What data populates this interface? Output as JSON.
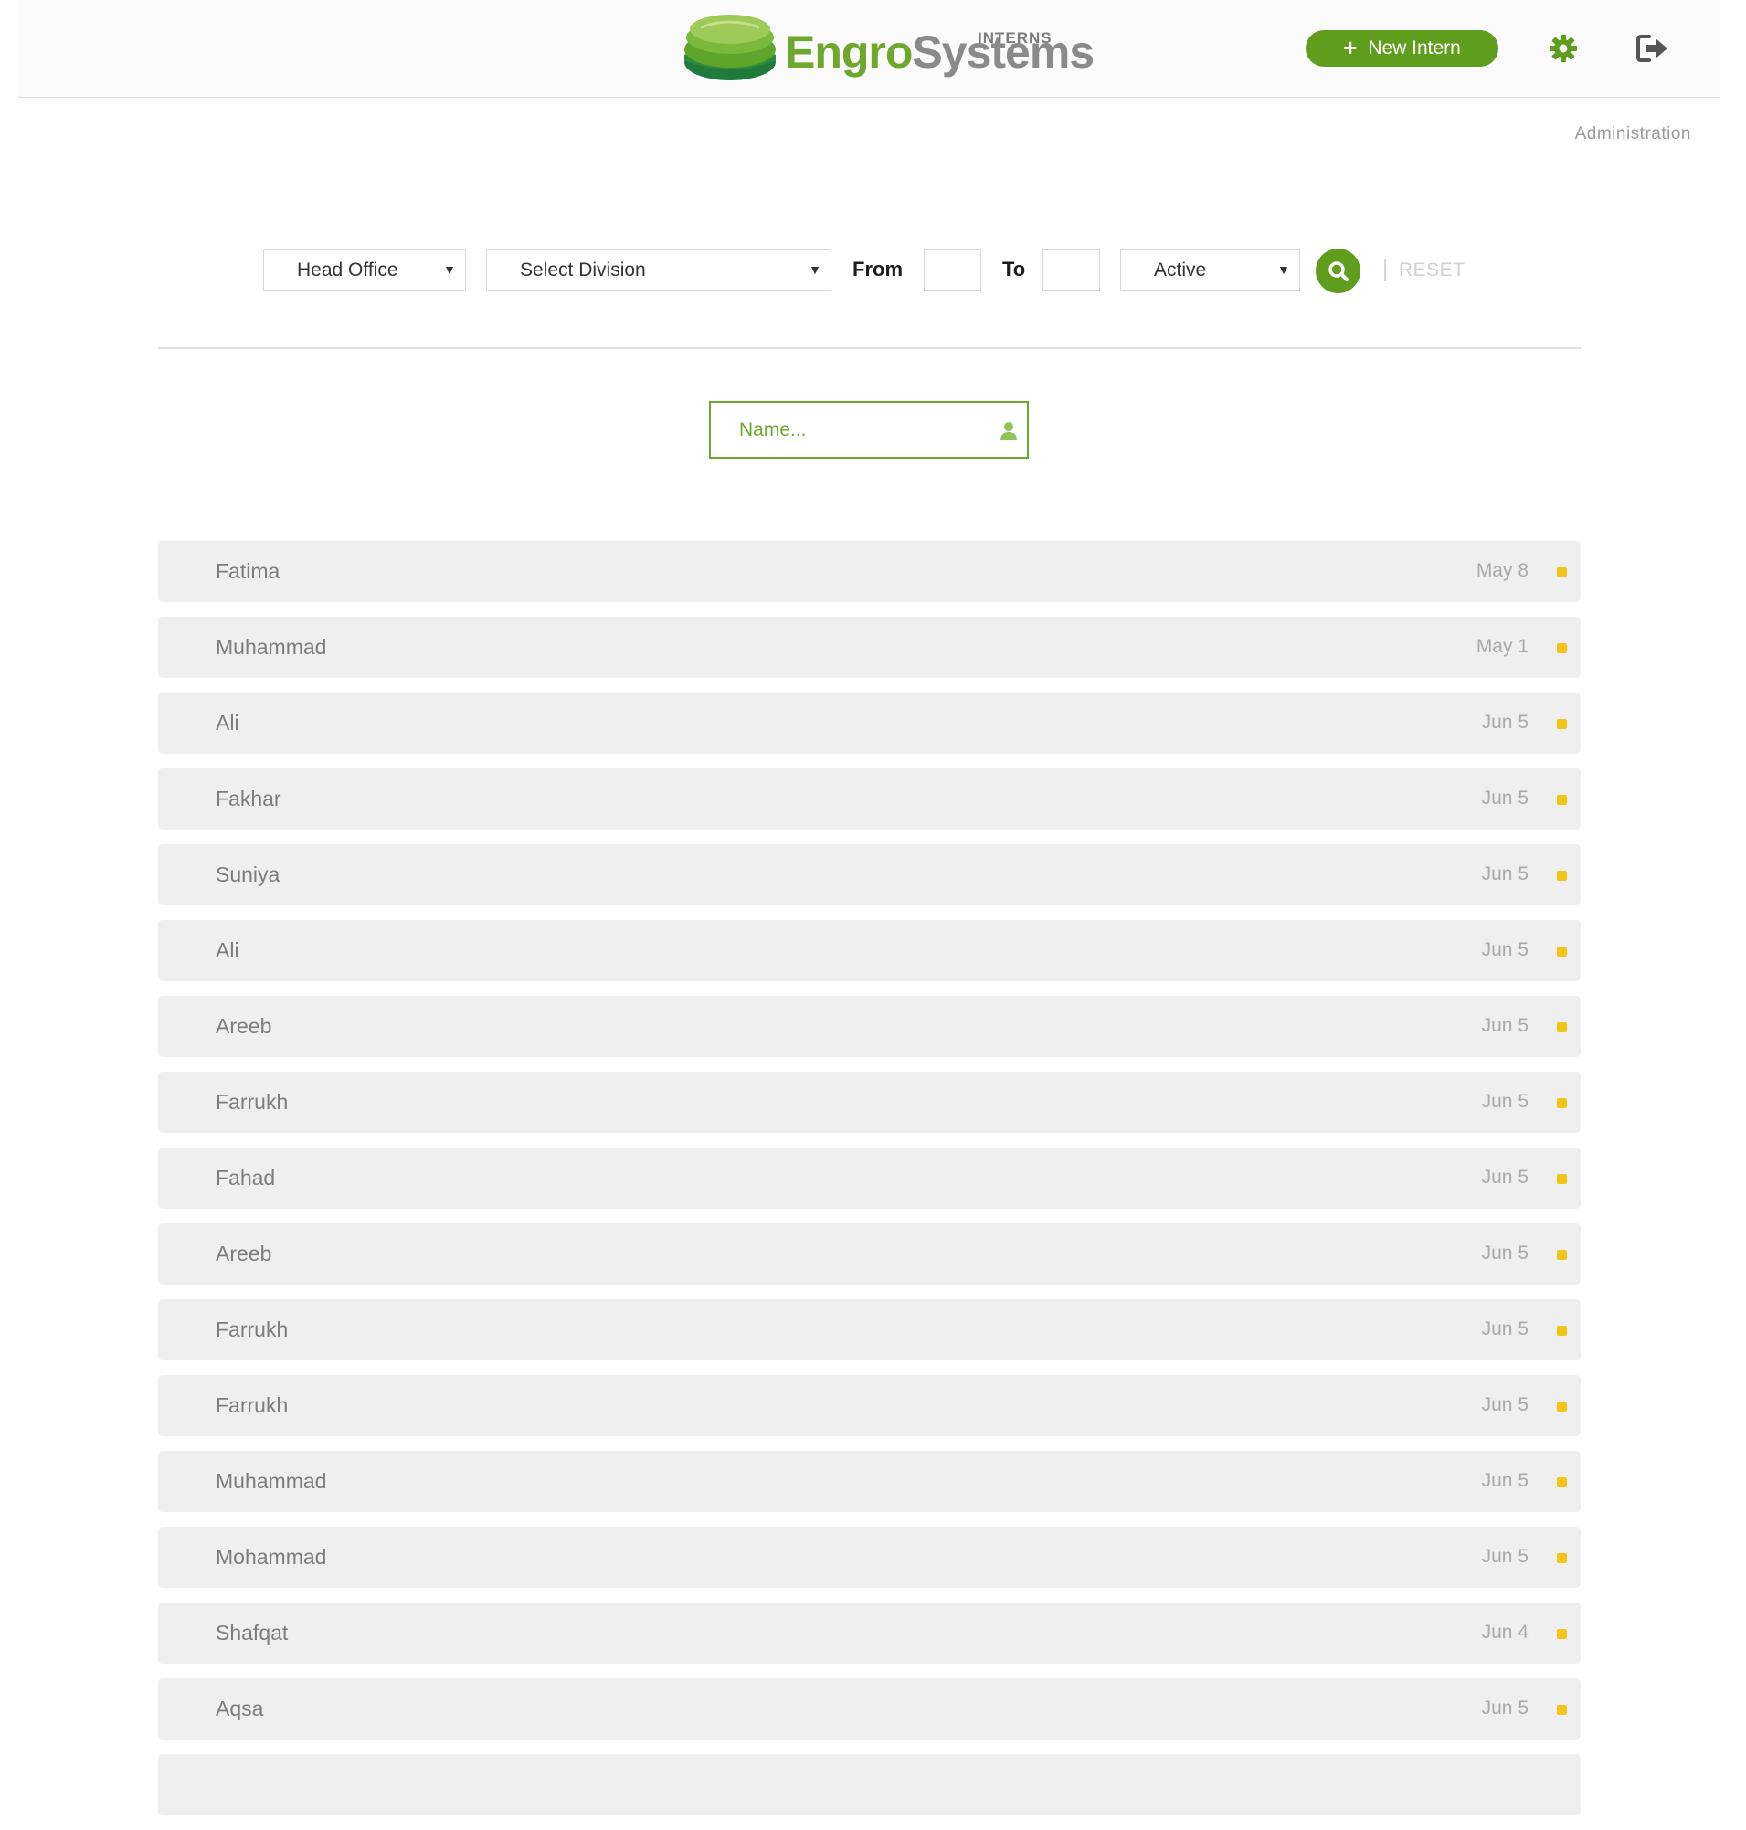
{
  "brand": {
    "word_green": "Engro",
    "word_grey": "Systems",
    "tag": "INTERNS",
    "color_green": "#6fa72d",
    "color_grey": "#8a8a8a"
  },
  "header": {
    "new_intern_label": "New Intern",
    "new_intern_icon": "plus-icon",
    "settings_icon": "gear-icon",
    "logout_icon": "sign-out-icon"
  },
  "admin_link": "Administration",
  "filters": {
    "office": "Head Office",
    "division": "Select Division",
    "from_label": "From",
    "to_label": "To",
    "from_value": "",
    "to_value": "",
    "status": "Active",
    "search_icon": "search-icon",
    "reset_label": "RESET"
  },
  "name_search": {
    "placeholder": "Name...",
    "value": "",
    "icon": "user-icon"
  },
  "status_color": "#f3c418",
  "interns": [
    {
      "name": "Fatima",
      "date": "May 8"
    },
    {
      "name": "Muhammad",
      "date": "May 1"
    },
    {
      "name": "Ali",
      "date": "Jun 5"
    },
    {
      "name": "Fakhar",
      "date": "Jun 5"
    },
    {
      "name": "Suniya",
      "date": "Jun 5"
    },
    {
      "name": "Ali",
      "date": "Jun 5"
    },
    {
      "name": "Areeb",
      "date": "Jun 5"
    },
    {
      "name": "Farrukh",
      "date": "Jun 5"
    },
    {
      "name": "Fahad",
      "date": "Jun 5"
    },
    {
      "name": "Areeb",
      "date": "Jun 5"
    },
    {
      "name": "Farrukh",
      "date": "Jun 5"
    },
    {
      "name": "Farrukh",
      "date": "Jun 5"
    },
    {
      "name": "Muhammad",
      "date": "Jun 5"
    },
    {
      "name": "Mohammad",
      "date": "Jun 5"
    },
    {
      "name": "Shafqat",
      "date": "Jun 4"
    },
    {
      "name": "Aqsa",
      "date": "Jun 5"
    },
    {
      "name": "",
      "date": ""
    }
  ]
}
